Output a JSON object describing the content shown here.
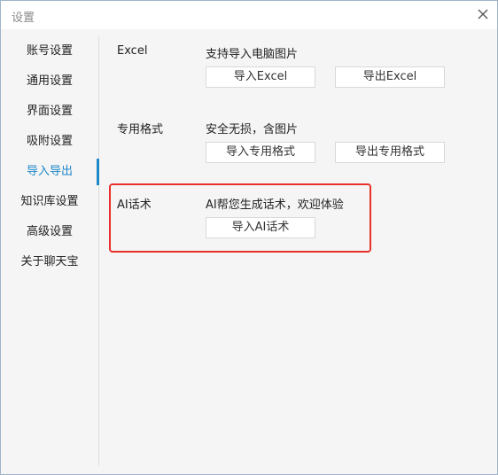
{
  "window": {
    "title": "设置"
  },
  "icons": {
    "close": "close-icon"
  },
  "colors": {
    "accent": "#1e88c8",
    "highlight": "#e8312a"
  },
  "sidebar": {
    "items": [
      {
        "label": "账号设置"
      },
      {
        "label": "通用设置"
      },
      {
        "label": "界面设置"
      },
      {
        "label": "吸附设置"
      },
      {
        "label": "导入导出"
      },
      {
        "label": "知识库设置"
      },
      {
        "label": "高级设置"
      },
      {
        "label": "关于聊天宝"
      }
    ],
    "active_index": 4
  },
  "sections": [
    {
      "label": "Excel",
      "description": "支持导入电脑图片",
      "buttons": [
        "导入Excel",
        "导出Excel"
      ]
    },
    {
      "label": "专用格式",
      "description": "安全无损，含图片",
      "buttons": [
        "导入专用格式",
        "导出专用格式"
      ]
    },
    {
      "label": "AI话术",
      "description": "AI帮您生成话术，欢迎体验",
      "buttons": [
        "导入AI话术"
      ]
    }
  ]
}
